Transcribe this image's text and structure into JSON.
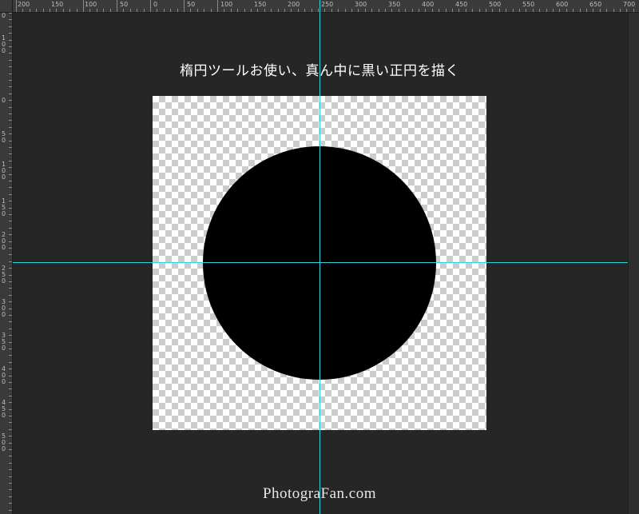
{
  "rulers": {
    "top_labels": [
      "200",
      "150",
      "100",
      "50",
      "0",
      "50",
      "100",
      "150",
      "200",
      "250",
      "300",
      "350",
      "400",
      "450",
      "500",
      "550",
      "600",
      "650",
      "700"
    ],
    "left_labels": [
      "0",
      "100",
      "0",
      "50",
      "100",
      "150",
      "200",
      "250",
      "300",
      "350",
      "400",
      "450",
      "500"
    ]
  },
  "canvas": {
    "background": "#262626",
    "document_background": "transparent-checkerboard",
    "shape": "black-circle",
    "shape_color": "#000000",
    "guide_color": "#2fd3e0"
  },
  "caption": "楕円ツールお使い、真ん中に黒い正円を描く",
  "watermark": "PhotograFan.com"
}
